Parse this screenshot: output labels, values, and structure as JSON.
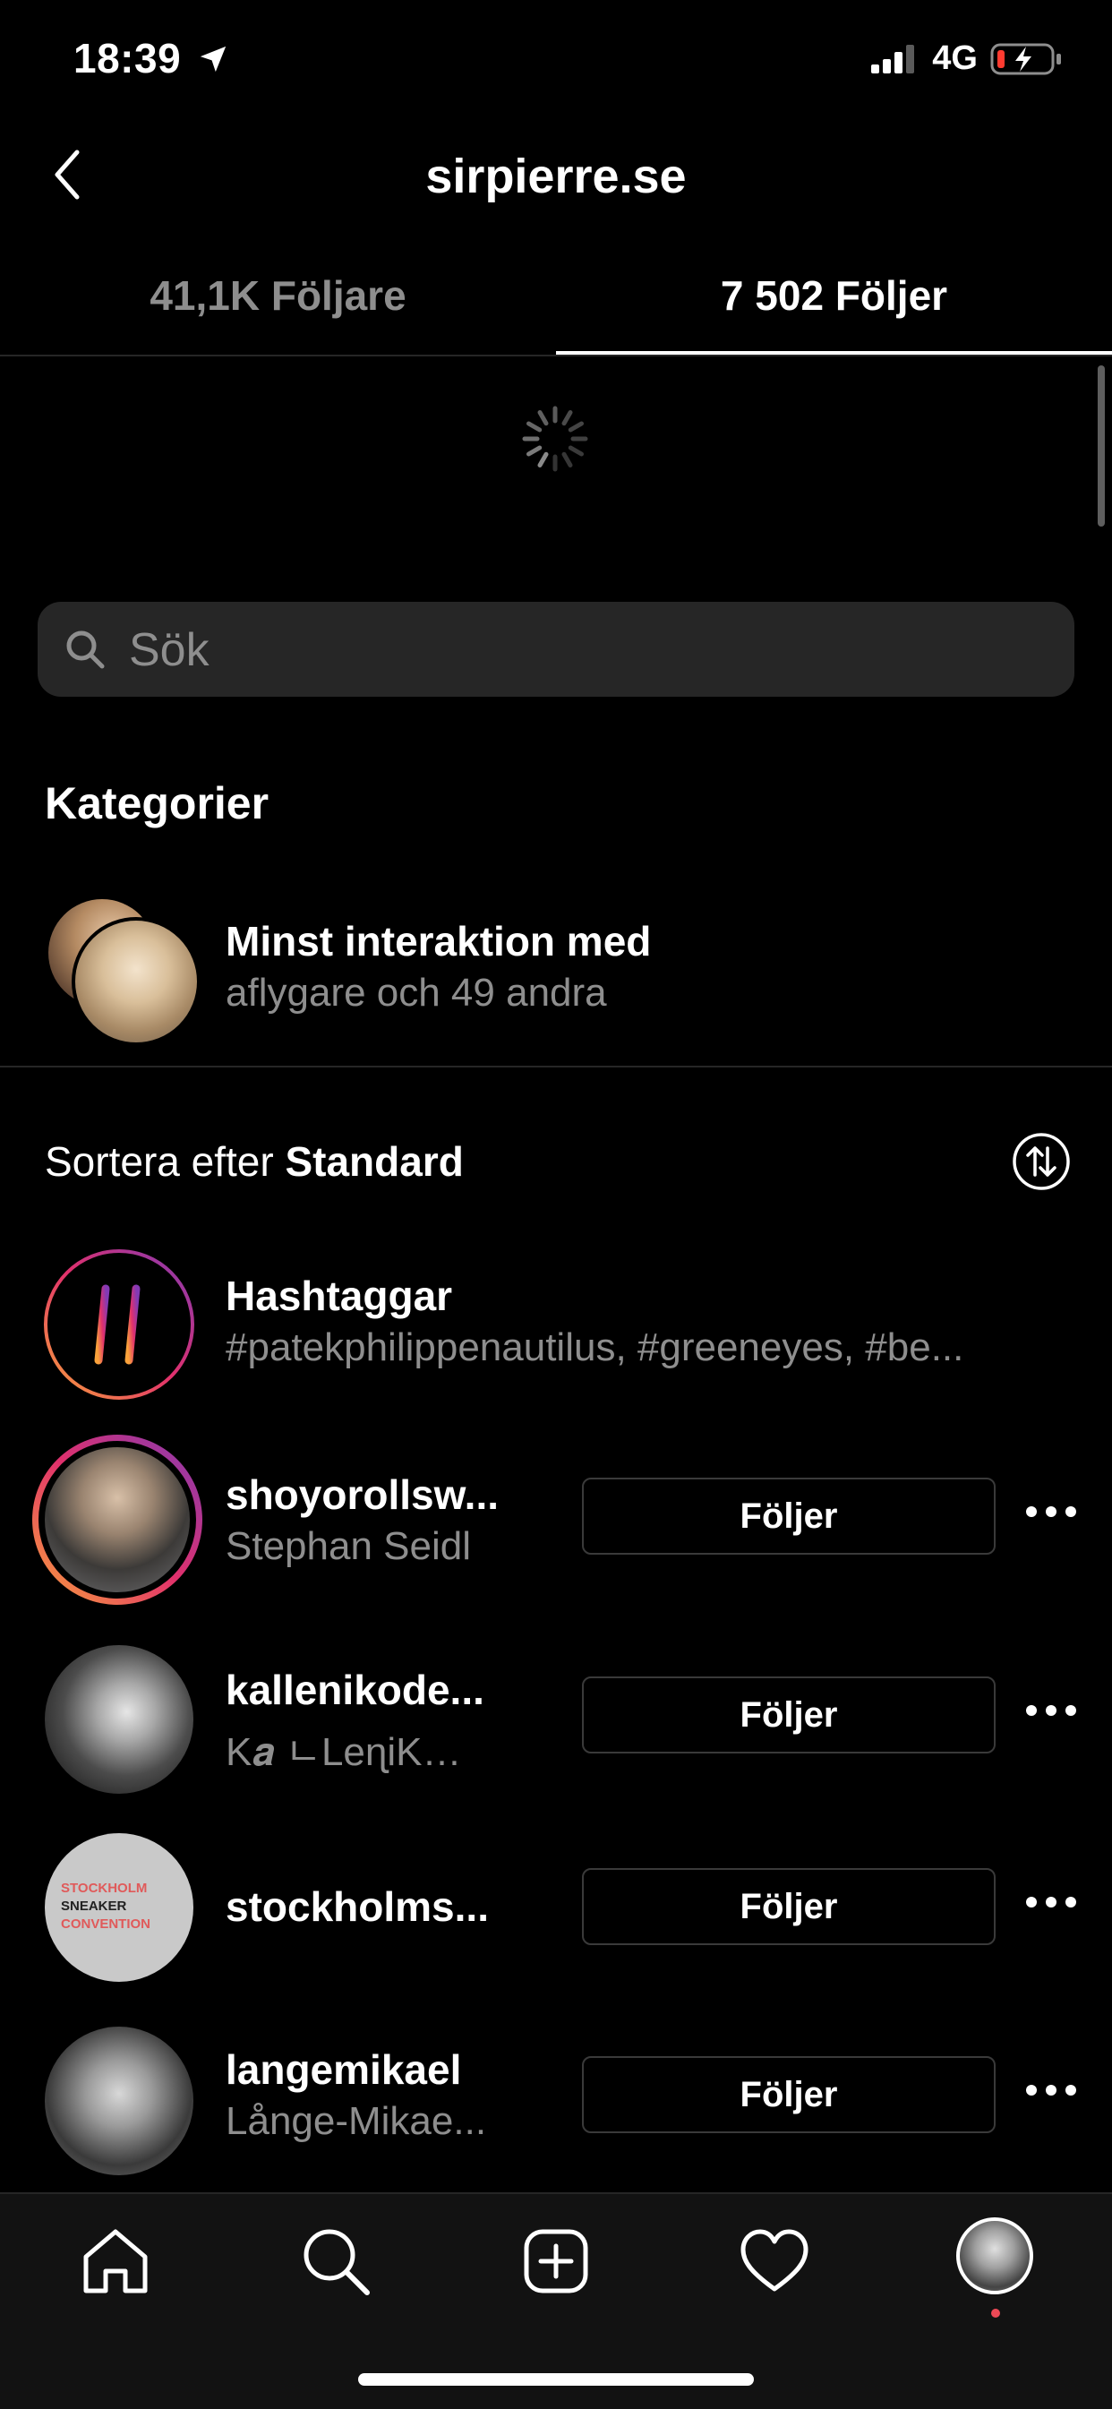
{
  "status_bar": {
    "time": "18:39",
    "network": "4G"
  },
  "header": {
    "title": "sirpierre.se"
  },
  "tabs": [
    {
      "label": "41,1K Följare",
      "active": false
    },
    {
      "label": "7 502 Följer",
      "active": true
    }
  ],
  "search": {
    "placeholder": "Sök"
  },
  "categories": {
    "title": "Kategorier",
    "item": {
      "title": "Minst interaktion med",
      "subtitle": "aflygare och 49 andra"
    }
  },
  "sort": {
    "prefix": "Sortera efter",
    "value": "Standard"
  },
  "hashtags": {
    "title": "Hashtaggar",
    "subtitle": "#patekphilippenautilus, #greeneyes, #be..."
  },
  "following": [
    {
      "username": "shoyorollsw...",
      "fullname": "Stephan Seidl",
      "button": "Följer",
      "story": true
    },
    {
      "username": "kallenikode...",
      "fullname": "K𝒂 ㄴLeɳiK…",
      "button": "Följer",
      "story": false
    },
    {
      "username": "stockholms...",
      "fullname": "",
      "button": "Följer",
      "story": false,
      "avatar_text": [
        "STOCKHOLM",
        "SNEAKER",
        "CONVENTION"
      ]
    },
    {
      "username": "langemikael",
      "fullname": "Långe-Mikae...",
      "button": "Följer",
      "story": false
    }
  ],
  "nav": [
    "home-icon",
    "search-icon",
    "new-post-icon",
    "activity-heart-icon",
    "profile-avatar"
  ],
  "colors": {
    "background": "#000000",
    "secondary_text": "#8e8e8e",
    "search_bg": "#262626",
    "notification_dot": "#ed4956"
  }
}
